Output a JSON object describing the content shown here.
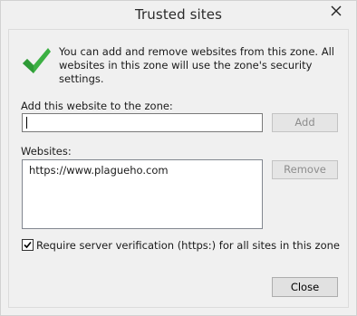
{
  "window": {
    "title": "Trusted sites",
    "close_icon": "close-icon"
  },
  "intro": {
    "icon": "checkmark-icon",
    "text": "You can add and remove websites from this zone. All websites in this zone will use the zone's security settings."
  },
  "add_site": {
    "label": "Add this website to the zone:",
    "input_value": "",
    "add_button": "Add"
  },
  "websites": {
    "label": "Websites:",
    "items": [
      "https://www.plagueho.com"
    ],
    "remove_button": "Remove"
  },
  "require_verification": {
    "label": "Require server verification (https:) for all sites in this zone",
    "checked": true
  },
  "footer": {
    "close_button": "Close"
  },
  "colors": {
    "check_green": "#3cb043",
    "accent": "#0078d7"
  }
}
